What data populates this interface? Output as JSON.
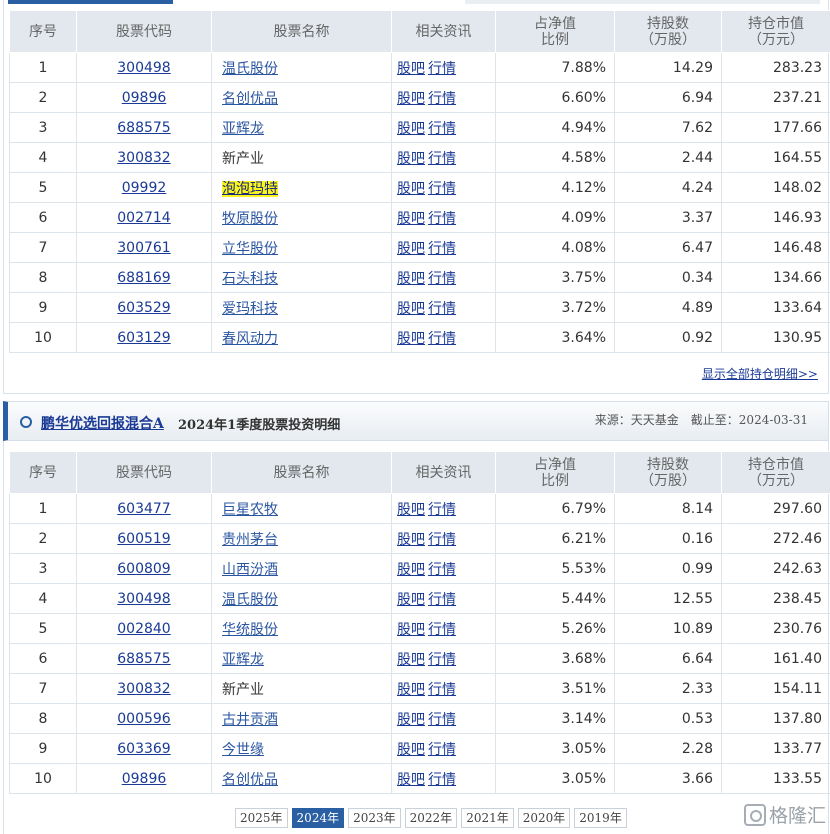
{
  "columns": [
    "序号",
    "股票代码",
    "股票名称",
    "相关资讯",
    "占净值\n比例",
    "持股数\n（万股）",
    "持仓市值\n（万元）"
  ],
  "news_links": [
    "股吧",
    "行情"
  ],
  "table1": [
    {
      "no": "1",
      "code": "300498",
      "name": "温氏股份",
      "ratio": "7.88%",
      "shares": "14.29",
      "value": "283.23"
    },
    {
      "no": "2",
      "code": "09896",
      "name": "名创优品",
      "ratio": "6.60%",
      "shares": "6.94",
      "value": "237.21"
    },
    {
      "no": "3",
      "code": "688575",
      "name": "亚辉龙",
      "ratio": "4.94%",
      "shares": "7.62",
      "value": "177.66"
    },
    {
      "no": "4",
      "code": "300832",
      "name": "新产业",
      "ratio": "4.58%",
      "shares": "2.44",
      "value": "164.55"
    },
    {
      "no": "5",
      "code": "09992",
      "name": "泡泡玛特",
      "ratio": "4.12%",
      "shares": "4.24",
      "value": "148.02"
    },
    {
      "no": "6",
      "code": "002714",
      "name": "牧原股份",
      "ratio": "4.09%",
      "shares": "3.37",
      "value": "146.93"
    },
    {
      "no": "7",
      "code": "300761",
      "name": "立华股份",
      "ratio": "4.08%",
      "shares": "6.47",
      "value": "146.48"
    },
    {
      "no": "8",
      "code": "688169",
      "name": "石头科技",
      "ratio": "3.75%",
      "shares": "0.34",
      "value": "134.66"
    },
    {
      "no": "9",
      "code": "603529",
      "name": "爱玛科技",
      "ratio": "3.72%",
      "shares": "4.89",
      "value": "133.64"
    },
    {
      "no": "10",
      "code": "603129",
      "name": "春风动力",
      "ratio": "3.64%",
      "shares": "0.92",
      "value": "130.95"
    }
  ],
  "show_all_link": "显示全部持仓明细>>",
  "section2": {
    "fund_name": "鹏华优选回报混合A",
    "title": "2024年1季度股票投资明细",
    "source": "来源：天天基金　截止至：2024-03-31"
  },
  "table2": [
    {
      "no": "1",
      "code": "603477",
      "name": "巨星农牧",
      "ratio": "6.79%",
      "shares": "8.14",
      "value": "297.60"
    },
    {
      "no": "2",
      "code": "600519",
      "name": "贵州茅台",
      "ratio": "6.21%",
      "shares": "0.16",
      "value": "272.46"
    },
    {
      "no": "3",
      "code": "600809",
      "name": "山西汾酒",
      "ratio": "5.53%",
      "shares": "0.99",
      "value": "242.63"
    },
    {
      "no": "4",
      "code": "300498",
      "name": "温氏股份",
      "ratio": "5.44%",
      "shares": "12.55",
      "value": "238.45"
    },
    {
      "no": "5",
      "code": "002840",
      "name": "华统股份",
      "ratio": "5.26%",
      "shares": "10.89",
      "value": "230.76"
    },
    {
      "no": "6",
      "code": "688575",
      "name": "亚辉龙",
      "ratio": "3.68%",
      "shares": "6.64",
      "value": "161.40"
    },
    {
      "no": "7",
      "code": "300832",
      "name": "新产业",
      "ratio": "3.51%",
      "shares": "2.33",
      "value": "154.11"
    },
    {
      "no": "8",
      "code": "000596",
      "name": "古井贡酒",
      "ratio": "3.14%",
      "shares": "0.53",
      "value": "137.80"
    },
    {
      "no": "9",
      "code": "603369",
      "name": "今世缘",
      "ratio": "3.05%",
      "shares": "2.28",
      "value": "133.77"
    },
    {
      "no": "10",
      "code": "09896",
      "name": "名创优品",
      "ratio": "3.05%",
      "shares": "3.66",
      "value": "133.55"
    }
  ],
  "years": [
    "2025年",
    "2024年",
    "2023年",
    "2022年",
    "2021年",
    "2020年",
    "2019年"
  ],
  "active_year": "2024年",
  "highlight_name": "泡泡玛特",
  "plain_names": [
    "新产业"
  ],
  "watermark": "格隆汇",
  "colors": {
    "accent": "#2a5fa3",
    "link": "#1a3a95",
    "header_bg": "#e2e8ee",
    "highlight": "#fbf51c"
  }
}
